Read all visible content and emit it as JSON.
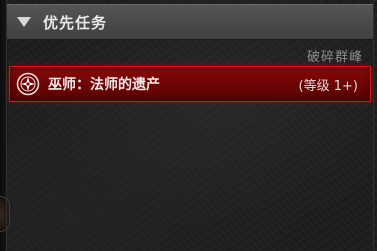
{
  "panel": {
    "header": {
      "title": "优先任务",
      "collapse_icon": "triangle-down-icon"
    },
    "region_name": "破碎群峰",
    "quest": {
      "icon": "priority-quest-icon",
      "title": "巫师：法师的遗产",
      "level": "(等级 1+)",
      "highlight_color": "#8a0a0a",
      "border_color": "#d21818"
    }
  }
}
